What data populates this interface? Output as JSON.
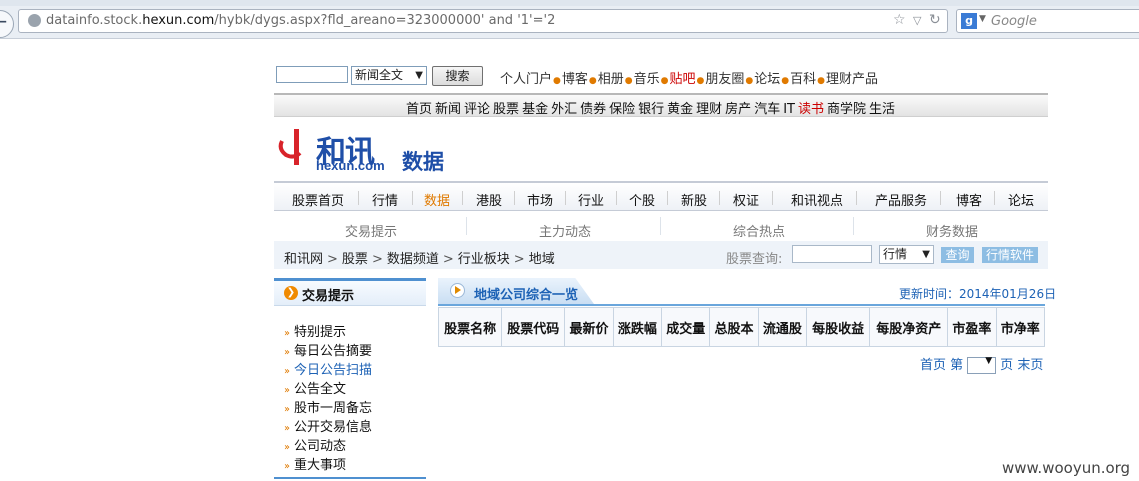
{
  "browser": {
    "url_host_prefix": "datainfo.stock.",
    "url_host_bold": "hexun.com",
    "url_rest": "/hybk/dygs.aspx?fld_areano=323000000' and '1'='2",
    "search_engine_placeholder": "Google"
  },
  "top_search": {
    "select_value": "新闻全文",
    "button_label": "搜索",
    "links": [
      "个人门户",
      "博客",
      "相册",
      "音乐",
      "贴吧",
      "朋友圈",
      "论坛",
      "百科",
      "理财产品"
    ]
  },
  "channel_nav": [
    "首页",
    "新闻",
    "评论",
    "股票",
    "基金",
    "外汇",
    "债券",
    "保险",
    "银行",
    "黄金",
    "理财",
    "房产",
    "汽车",
    "IT",
    "读书",
    "商学院",
    "生活"
  ],
  "logo": {
    "cn": "和讯",
    "en": "hexun.com",
    "sub": "数据"
  },
  "main_nav": [
    "股票首页",
    "行情",
    "数据",
    "港股",
    "市场",
    "行业",
    "个股",
    "新股",
    "权证",
    "和讯视点",
    "产品服务",
    "博客",
    "论坛"
  ],
  "sub_nav": [
    "交易提示",
    "主力动态",
    "综合热点",
    "财务数据"
  ],
  "breadcrumb": [
    "和讯网",
    "股票",
    "数据频道",
    "行业板块",
    "地域"
  ],
  "quote": {
    "label": "股票查询:",
    "select_value": "行情",
    "query_button": "查询",
    "software_button": "行情软件"
  },
  "sidebar": {
    "title": "交易提示",
    "items": [
      "特别提示",
      "每日公告摘要",
      "今日公告扫描",
      "公告全文",
      "股市一周备忘",
      "公开交易信息",
      "公司动态",
      "重大事项"
    ]
  },
  "panel": {
    "title": "地域公司综合一览",
    "update": "更新时间：2014年01月26日",
    "columns": [
      "股票名称",
      "股票代码",
      "最新价",
      "涨跌幅",
      "成交量",
      "总股本",
      "流通股",
      "每股收益",
      "每股净资产",
      "市盈率",
      "市净率"
    ]
  },
  "pager": {
    "first": "首页",
    "page_prefix": "第",
    "page_suffix": "页",
    "last": "末页"
  },
  "watermark": "www.wooyun.org",
  "colors": {
    "link_blue": "#1d62b5",
    "accent_orange": "#e07a00",
    "logo_blue": "#1f4fa8"
  }
}
